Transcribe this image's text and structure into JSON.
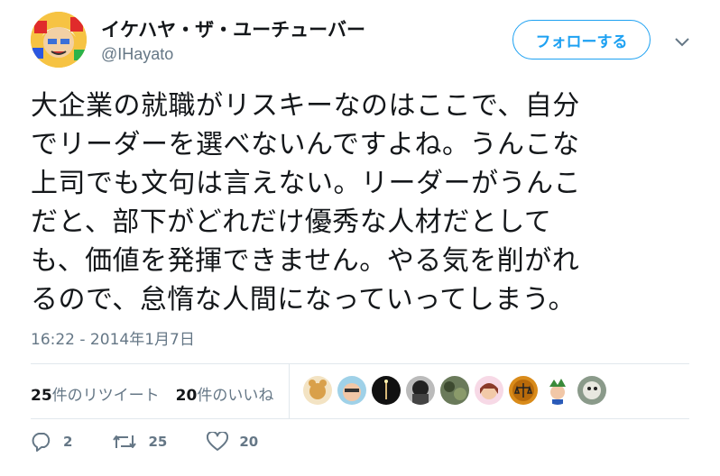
{
  "header": {
    "display_name": "イケハヤ・ザ・ユーチューバー",
    "handle": "@IHayato",
    "follow_label": "フォローする"
  },
  "tweet": {
    "text": "大企業の就職がリスキーなのはここで、自分\nでリーダーを選べないんですよね。うんこな\n上司でも文句は言えない。リーダーがうんこ\nだと、部下がどれだけ優秀な人材だとして\nも、価値を発揮できません。やる気を削がれ\nるので、怠惰な人間になっていってしまう。",
    "timestamp": "16:22 - 2014年1月7日"
  },
  "stats": {
    "retweets_count": "25",
    "retweets_label": "件のリツイート",
    "likes_count": "20",
    "likes_label": "件のいいね"
  },
  "actions": {
    "reply_count": "2",
    "retweet_count": "25",
    "like_count": "20"
  },
  "icons": {
    "reply": "reply-icon",
    "retweet": "retweet-icon",
    "like": "heart-icon",
    "more": "chevron-down-icon"
  },
  "colors": {
    "accent": "#1da1f2",
    "muted": "#657786",
    "text": "#14171a",
    "border": "#e1e8ed"
  }
}
